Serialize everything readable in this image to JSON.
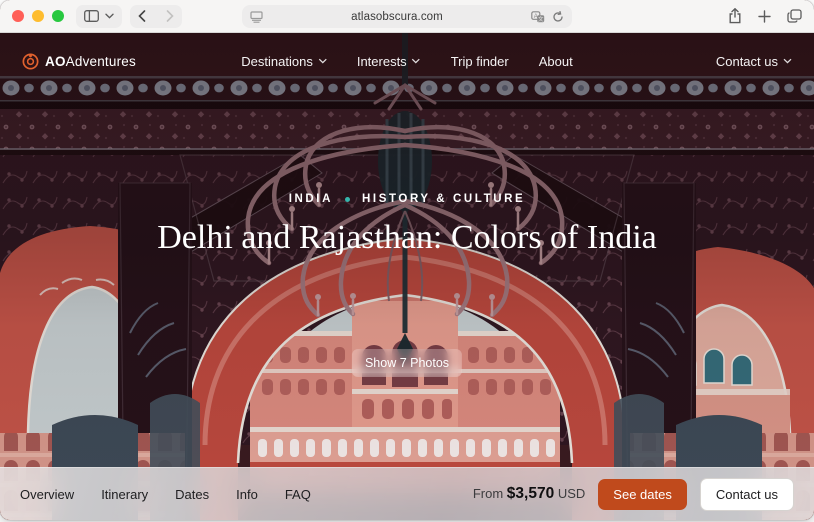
{
  "browser": {
    "url": "atlasobscura.com",
    "icons": {
      "traffic": [
        "close-icon",
        "minimize-icon",
        "zoom-icon"
      ],
      "toolbar_left": [
        "sidebar-icon",
        "chevron-down-icon",
        "back-icon",
        "forward-icon"
      ],
      "address_bar": [
        "page-menu-icon",
        "translate-icon",
        "reload-icon"
      ],
      "toolbar_right": [
        "share-icon",
        "new-tab-icon",
        "tab-overview-icon"
      ]
    }
  },
  "site_nav": {
    "logo_bold": "AO",
    "logo_text": "Adventures",
    "links": [
      {
        "label": "Destinations",
        "has_chevron": true
      },
      {
        "label": "Interests",
        "has_chevron": true
      },
      {
        "label": "Trip finder",
        "has_chevron": false
      },
      {
        "label": "About",
        "has_chevron": false
      }
    ],
    "contact_label": "Contact us"
  },
  "hero": {
    "breadcrumb": {
      "country": "INDIA",
      "category": "HISTORY & CULTURE"
    },
    "title": "Delhi and Rajasthan: Colors of India",
    "photos_button": "Show 7 Photos"
  },
  "bottom_bar": {
    "tabs": [
      "Overview",
      "Itinerary",
      "Dates",
      "Info",
      "FAQ"
    ],
    "price": {
      "prefix": "From",
      "amount": "$3,570",
      "currency": "USD"
    },
    "see_dates_label": "See dates",
    "contact_label": "Contact us"
  },
  "colors": {
    "accent_orange": "#c04a1c",
    "logo_orange": "#e2622e",
    "breadcrumb_dot_teal": "#35b5ac",
    "chrome_background": "#f6f5f4"
  }
}
